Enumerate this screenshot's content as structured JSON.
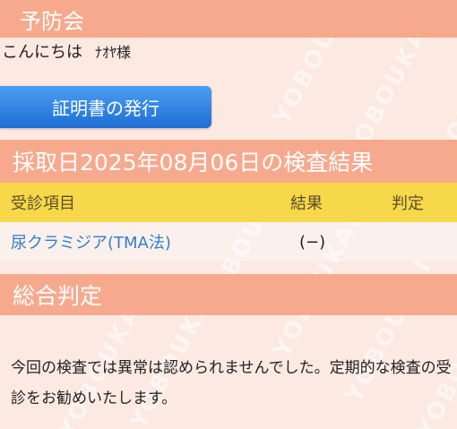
{
  "header": {
    "title": "予防会"
  },
  "greeting": {
    "text": "こんにちは",
    "user": "ﾅｵﾔ様"
  },
  "actions": {
    "certificate_button": "証明書の発行"
  },
  "results": {
    "title": "採取日2025年08月06日の検査結果",
    "columns": {
      "item": "受診項目",
      "result": "結果",
      "judgement": "判定"
    },
    "rows": [
      {
        "item": "尿クラミジア(TMA法)",
        "result": "(−)",
        "judgement": ""
      }
    ]
  },
  "overall": {
    "title": "総合判定",
    "message": "今回の検査では異常は認められませんでした。定期的な検査の受診をお勧めいたします。"
  },
  "watermark": {
    "text": "YOBOUKAI"
  },
  "colors": {
    "band": "#f7a98e",
    "background": "#fbe9e2",
    "table_header": "#f7d84a",
    "button": "#1f6fd6",
    "link_text": "#2f7fd0"
  }
}
